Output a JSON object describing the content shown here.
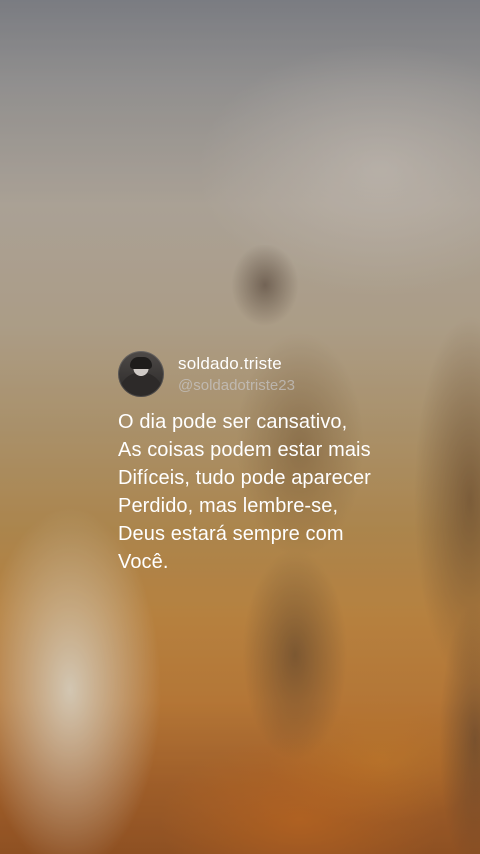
{
  "post": {
    "display_name": "soldado.triste",
    "handle": "@soldadotriste23",
    "lines": [
      "O dia pode ser cansativo,",
      "As coisas podem estar mais",
      "Difíceis, tudo pode aparecer",
      "Perdido, mas lembre-se,",
      "Deus estará sempre com",
      "Você."
    ]
  },
  "colors": {
    "text": "#ffffff",
    "handle": "#d2d7e1"
  }
}
